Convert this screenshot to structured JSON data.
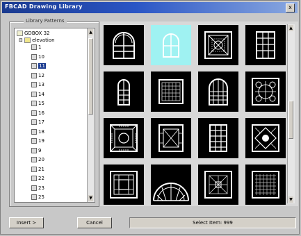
{
  "window": {
    "title": "FBCAD Drawing Library",
    "close_label": "x"
  },
  "library": {
    "label": "Library Patterns"
  },
  "tree": {
    "root_label": "GDBOX 32",
    "folder_label": "elevation",
    "items": [
      "1",
      "10",
      "11",
      "12",
      "13",
      "14",
      "15",
      "16",
      "17",
      "18",
      "19",
      "9",
      "20",
      "21",
      "22",
      "23",
      "25"
    ],
    "selected_index": 2
  },
  "grid": {
    "selected_tile": 1
  },
  "footer": {
    "insert_label": "Insert >",
    "cancel_label": "Cancel",
    "status_text": "Select Item: 999"
  }
}
